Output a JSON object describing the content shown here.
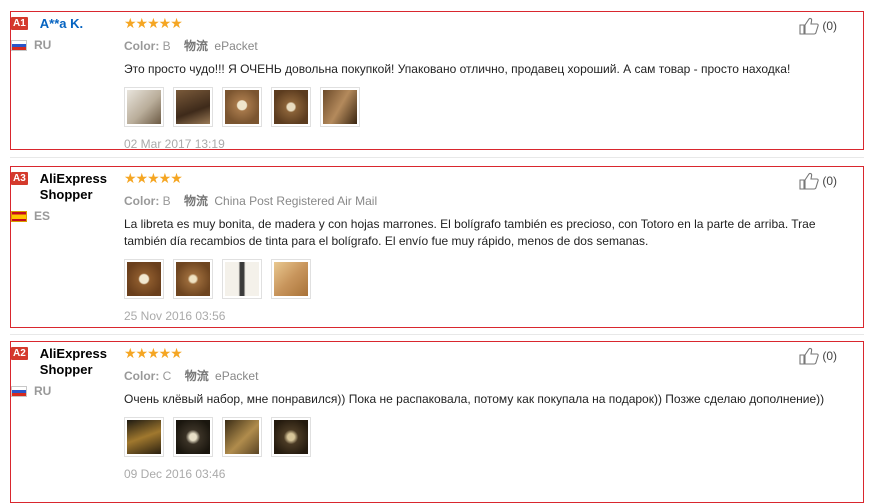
{
  "reviews": [
    {
      "badge": "A1",
      "username": "A**a K.",
      "country": "RU",
      "color_label": "Color:",
      "color_value": "B",
      "shipping_label": "物流",
      "shipping_value": "ePacket",
      "text": "Это просто чудо!!! Я ОЧЕНЬ довольна покупкой! Упаковано отлично, продавец хороший. А сам товар - просто находка!",
      "date": "02 Mar 2017 13:19",
      "helpful": "(0)",
      "photos": [
        "photo-1",
        "photo-2",
        "photo-3",
        "photo-4",
        "photo-5"
      ]
    },
    {
      "badge": "A3",
      "username": "AliExpress Shopper",
      "country": "ES",
      "color_label": "Color:",
      "color_value": "B",
      "shipping_label": "物流",
      "shipping_value": "China Post Registered Air Mail",
      "text": "La libreta es muy bonita, de madera y con hojas marrones. El bolígrafo también es precioso, con Totoro en la parte de arriba. Trae también día recambios de tinta para el bolígrafo. El envío fue muy rápido, menos de dos semanas.",
      "date": "25 Nov 2016 03:56",
      "helpful": "(0)",
      "photos": [
        "photo-1",
        "photo-2",
        "photo-3",
        "photo-4"
      ]
    },
    {
      "badge": "A2",
      "username": "AliExpress Shopper",
      "country": "RU",
      "color_label": "Color:",
      "color_value": "C",
      "shipping_label": "物流",
      "shipping_value": "ePacket",
      "text": "Очень клёвый набор, мне понравился)) Пока не распаковала, потому как покупала на подарок)) Позже сделаю дополнение))",
      "date": "09 Dec 2016 03:46",
      "helpful": "(0)",
      "photos": [
        "photo-1",
        "photo-2",
        "photo-3",
        "photo-4"
      ]
    }
  ],
  "stars_glyph": "★★★★★",
  "icons": {
    "helpful": "thumbs-up-icon",
    "flag_ru": "flag-ru-icon",
    "flag_es": "flag-es-icon"
  }
}
